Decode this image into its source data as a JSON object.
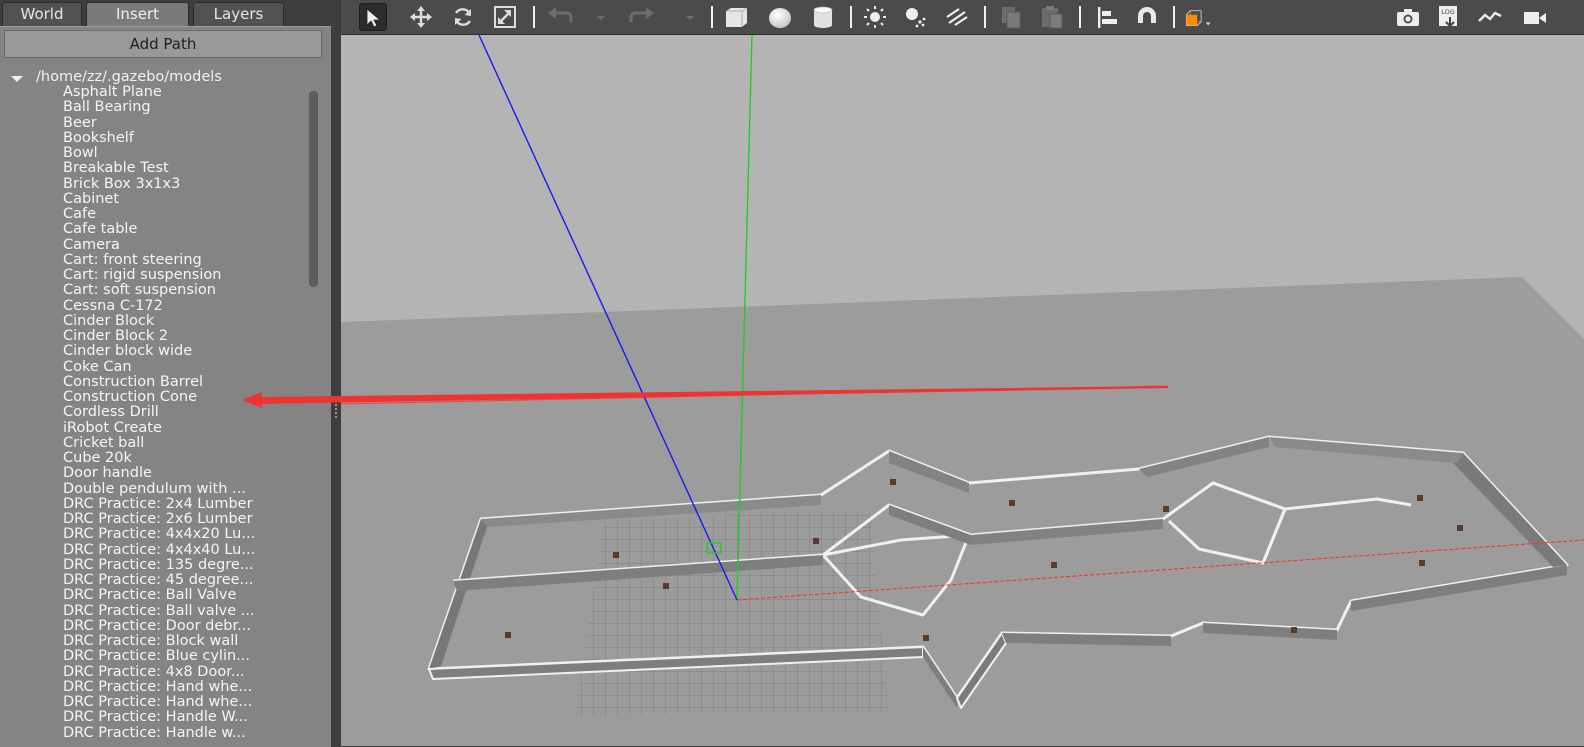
{
  "tabs": [
    "World",
    "Insert",
    "Layers"
  ],
  "active_tab": "Insert",
  "insert": {
    "add_path_label": "Add Path",
    "root_path": "/home/zz/.gazebo/models",
    "models": [
      "Asphalt Plane",
      "Ball Bearing",
      "Beer",
      "Bookshelf",
      "Bowl",
      "Breakable Test",
      "Brick Box 3x1x3",
      "Cabinet",
      "Cafe",
      "Cafe table",
      "Camera",
      "Cart: front steering",
      "Cart: rigid suspension",
      "Cart: soft suspension",
      "Cessna C-172",
      "Cinder Block",
      "Cinder Block 2",
      "Cinder block wide",
      "Coke Can",
      "Construction Barrel",
      "Construction Cone",
      "Cordless Drill",
      "iRobot Create",
      "Cricket ball",
      "Cube 20k",
      "Door handle",
      "Double pendulum with ...",
      "DRC Practice: 2x4 Lumber",
      "DRC Practice: 2x6 Lumber",
      "DRC Practice: 4x4x20 Lu...",
      "DRC Practice: 4x4x40 Lu...",
      "DRC Practice: 135 degre...",
      "DRC Practice: 45 degree...",
      "DRC Practice: Ball Valve",
      "DRC Practice: Ball valve ...",
      "DRC Practice: Door debr...",
      "DRC Practice: Block wall",
      "DRC Practice: Blue cylin...",
      "DRC Practice: 4x8 Door...",
      "DRC Practice: Hand whe...",
      "DRC Practice: Hand whe...",
      "DRC Practice: Handle W...",
      "DRC Practice: Handle w..."
    ]
  },
  "toolbar": {
    "left_tools": [
      {
        "icon": "select-arrow-icon",
        "active": true
      },
      {
        "icon": "translate-icon"
      },
      {
        "icon": "rotate-icon"
      },
      {
        "icon": "scale-icon"
      },
      {
        "icon": "undo-icon",
        "disabled": true
      },
      {
        "icon": "undo-dropdown-icon",
        "disabled": true
      },
      {
        "icon": "redo-icon",
        "disabled": true
      },
      {
        "icon": "redo-dropdown-icon",
        "disabled": true
      },
      {
        "icon": "box-shape-icon"
      },
      {
        "icon": "sphere-shape-icon"
      },
      {
        "icon": "cylinder-shape-icon"
      },
      {
        "icon": "point-light-icon"
      },
      {
        "icon": "spot-light-icon"
      },
      {
        "icon": "directional-light-icon"
      },
      {
        "icon": "copy-icon",
        "disabled": true
      },
      {
        "icon": "paste-icon",
        "disabled": true
      },
      {
        "icon": "align-icon"
      },
      {
        "icon": "snap-magnet-icon"
      },
      {
        "icon": "view-angle-icon"
      }
    ],
    "right_tools": [
      {
        "icon": "screenshot-camera-icon"
      },
      {
        "icon": "log-icon"
      },
      {
        "icon": "plot-icon"
      },
      {
        "icon": "video-record-icon"
      }
    ]
  },
  "colors": {
    "viewport_sky": "#b4b4b4",
    "ground": "#9c9c9c",
    "axis_x": "#ff2a2a",
    "axis_y": "#22cc22",
    "axis_z": "#1a1aee",
    "annotation_arrow": "#ee3333",
    "view_angle_orange": "#ff8a00"
  }
}
